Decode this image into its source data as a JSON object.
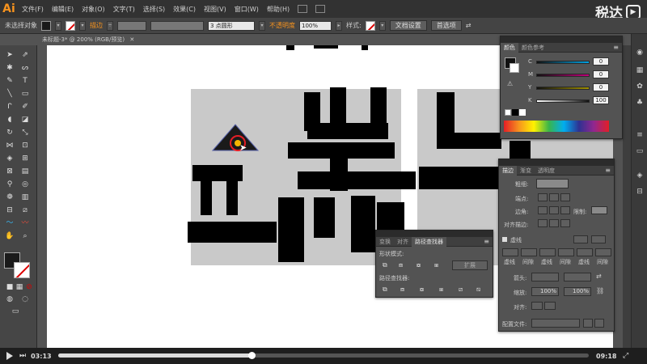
{
  "app": {
    "logo": "Ai",
    "menus": [
      "文件(F)",
      "编辑(E)",
      "对象(O)",
      "文字(T)",
      "选择(S)",
      "效果(C)",
      "视图(V)",
      "窗口(W)",
      "帮助(H)"
    ],
    "watermark": "税达",
    "watermark_icon": "play-box-icon"
  },
  "control_bar": {
    "selection_state": "未选择对象",
    "stroke_label": "描边",
    "brush_value": "3 点圆形",
    "opacity_label": "不透明度",
    "opacity_value": "100%",
    "style_label": "样式:",
    "doc_settings_btn": "文档设置",
    "preferences_btn": "首选项"
  },
  "document": {
    "tab_title": "未标题-3* @ 200% (RGB/预览)"
  },
  "color_panel": {
    "tabs": [
      "颜色",
      "颜色参考"
    ],
    "channels": [
      {
        "label": "C",
        "value": "0"
      },
      {
        "label": "M",
        "value": "0"
      },
      {
        "label": "Y",
        "value": "0"
      },
      {
        "label": "K",
        "value": "100"
      }
    ]
  },
  "stroke_panel": {
    "tabs": [
      "描边",
      "渐变",
      "透明度"
    ],
    "weight_label": "粗细:",
    "cap_label": "端点:",
    "corner_label": "边角:",
    "limit_label": "限制:",
    "align_label": "对齐描边:",
    "dash_label": "虚线",
    "dash_fields": [
      "虚线",
      "间隙",
      "虚线",
      "间隙",
      "虚线",
      "间隙"
    ],
    "arrow_label": "箭头:",
    "scale_label": "缩放:",
    "scale_value1": "100%",
    "scale_value2": "100%",
    "align2_label": "对齐:",
    "profile_label": "配置文件:"
  },
  "pathfinder_panel": {
    "tabs": [
      "变换",
      "对齐",
      "路径查找器"
    ],
    "shape_modes_label": "形状模式:",
    "expand_btn": "扩展",
    "pathfinders_label": "路径查找器:"
  },
  "player": {
    "current_time": "03:13",
    "total_time": "09:18",
    "progress": 0.364
  },
  "colors": {
    "accent_orange": "#f7931e",
    "cursor_ring": "#e41e26"
  }
}
